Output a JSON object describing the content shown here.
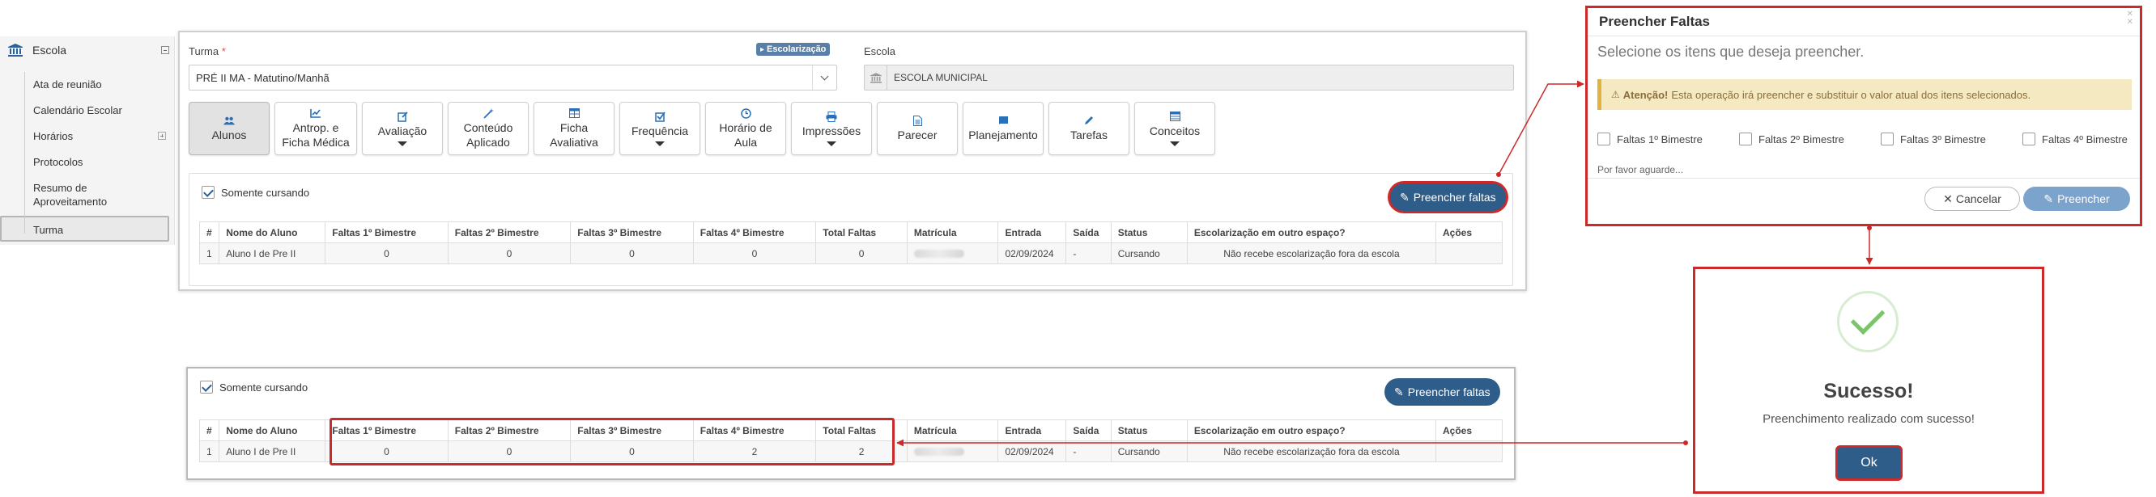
{
  "sidebar": {
    "title": "Escola",
    "items": [
      {
        "label": "Ata de reunião",
        "expandable": false
      },
      {
        "label": "Calendário Escolar",
        "expandable": false
      },
      {
        "label": "Horários",
        "expandable": true
      },
      {
        "label": "Protocolos",
        "expandable": false
      },
      {
        "label": "Resumo de Aproveitamento",
        "expandable": false
      },
      {
        "label": "Turma",
        "expandable": false,
        "active": true
      }
    ]
  },
  "form": {
    "turma_label": "Turma",
    "turma_required": "*",
    "badge": "Escolarização",
    "turma_value": "PRÉ II MA - Matutino/Manhã",
    "escola_label": "Escola",
    "escola_value": "ESCOLA MUNICIPAL"
  },
  "toolbar": {
    "buttons": [
      {
        "label": "Alunos",
        "icon": "users-icon",
        "active": true
      },
      {
        "label": "Antrop. e Ficha Médica",
        "icon": "chart-line-icon"
      },
      {
        "label": "Avaliação",
        "icon": "edit-icon",
        "dropdown": true
      },
      {
        "label": "Conteúdo Aplicado",
        "icon": "magic-wand-icon"
      },
      {
        "label": "Ficha Avaliativa",
        "icon": "table-icon"
      },
      {
        "label": "Frequência",
        "icon": "check-square-icon",
        "dropdown": true
      },
      {
        "label": "Horário de Aula",
        "icon": "clock-icon"
      },
      {
        "label": "Impressões",
        "icon": "print-icon",
        "dropdown": true
      },
      {
        "label": "Parecer",
        "icon": "file-icon"
      },
      {
        "label": "Planejamento",
        "icon": "book-icon"
      },
      {
        "label": "Tarefas",
        "icon": "pencil-icon"
      },
      {
        "label": "Conceitos",
        "icon": "list-table-icon",
        "dropdown": true
      }
    ]
  },
  "students": {
    "only_enrolled_label": "Somente cursando",
    "fill_button": "Preencher faltas",
    "columns": [
      "#",
      "Nome do Aluno",
      "Faltas 1º Bimestre",
      "Faltas 2º Bimestre",
      "Faltas 3º Bimestre",
      "Faltas 4º Bimestre",
      "Total Faltas",
      "Matrícula",
      "Entrada",
      "Saída",
      "Status",
      "Escolarização em outro espaço?",
      "Ações"
    ],
    "rows_before": [
      {
        "n": "1",
        "name": "Aluno I de Pre II",
        "f1": "0",
        "f2": "0",
        "f3": "0",
        "f4": "0",
        "total": "0",
        "entrada": "02/09/2024",
        "saida": "-",
        "status": "Cursando",
        "outro": "Não recebe escolarização fora da escola"
      }
    ],
    "rows_after": [
      {
        "n": "1",
        "name": "Aluno I de Pre II",
        "f1": "0",
        "f2": "0",
        "f3": "0",
        "f4": "2",
        "total": "2",
        "entrada": "02/09/2024",
        "saida": "-",
        "status": "Cursando",
        "outro": "Não recebe escolarização fora da escola"
      }
    ]
  },
  "fill_modal": {
    "title": "Preencher Faltas",
    "subtitle": "Selecione os itens que deseja preencher.",
    "warning_strong": "Atenção!",
    "warning_text": "Esta operação irá preencher e substituir o valor atual dos itens selecionados.",
    "options": [
      "Faltas 1º Bimestre",
      "Faltas 2º Bimestre",
      "Faltas 3º Bimestre",
      "Faltas 4º Bimestre"
    ],
    "waiting": "Por favor aguarde...",
    "cancel": "Cancelar",
    "confirm": "Preencher"
  },
  "success_modal": {
    "heading": "Sucesso!",
    "message": "Preenchimento realizado com sucesso!",
    "ok": "Ok"
  },
  "colors": {
    "primary": "#2f5d8a",
    "highlight": "#cc2a2a",
    "warning_bg": "#f5e9c2",
    "success": "#7cc36b"
  }
}
